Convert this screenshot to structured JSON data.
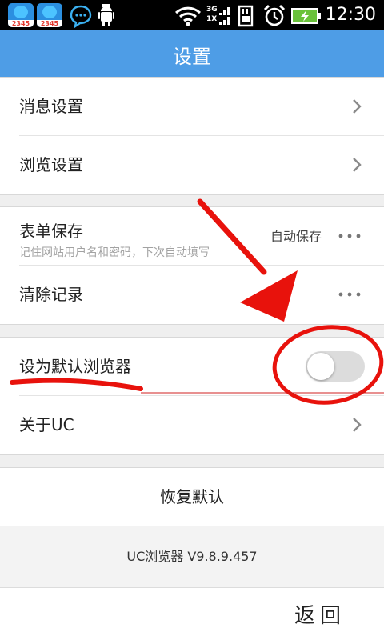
{
  "status_bar": {
    "time": "12:30",
    "network_top": "3G",
    "network_bottom": "1X",
    "app_icon_label": "2345"
  },
  "header": {
    "title": "设置"
  },
  "sections": {
    "nav": [
      {
        "label": "消息设置"
      },
      {
        "label": "浏览设置"
      }
    ],
    "form_save": {
      "label": "表单保存",
      "description": "记住网站用户名和密码，下次自动填写",
      "value": "自动保存"
    },
    "clear": {
      "label": "清除记录"
    },
    "default_browser": {
      "label": "设为默认浏览器",
      "enabled": false
    },
    "about": {
      "label": "关于UC"
    },
    "restore": {
      "label": "恢复默认"
    }
  },
  "footer": {
    "version": "UC浏览器 V9.8.9.457",
    "back_label": "返回"
  },
  "colors": {
    "title_bar": "#4e9de6",
    "annotation": "#e8120c"
  }
}
